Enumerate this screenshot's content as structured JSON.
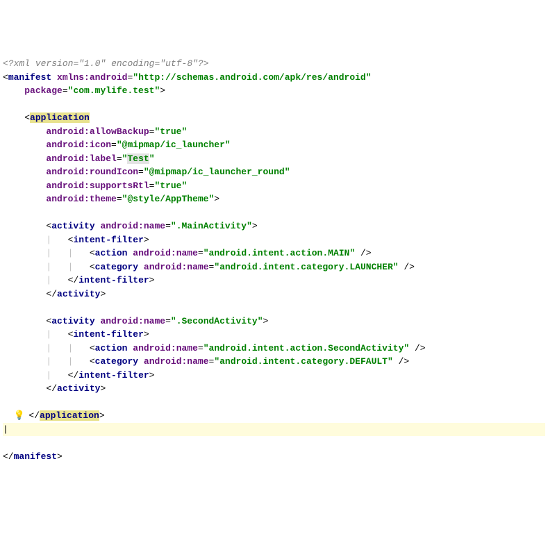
{
  "xml_decl": {
    "open": "<?",
    "name": "xml",
    "version_attr": "version",
    "version_val": "\"1.0\"",
    "encoding_attr": "encoding",
    "encoding_val": "\"utf-8\"",
    "close": "?>"
  },
  "manifest": {
    "tag": "manifest",
    "xmlns_attr": "xmlns:android",
    "xmlns_val": "\"http://schemas.android.com/apk/res/android\"",
    "package_attr": "package",
    "package_val": "\"com.mylife.test\"",
    "close": ">"
  },
  "application": {
    "tag": "application",
    "attrs": {
      "allowBackup": {
        "name": "android:allowBackup",
        "val": "\"true\""
      },
      "icon": {
        "name": "android:icon",
        "val": "\"@mipmap/ic_launcher\""
      },
      "label": {
        "name": "android:label",
        "val_q": "\"",
        "val_inner": "Test",
        "val_q2": "\""
      },
      "roundIcon": {
        "name": "android:roundIcon",
        "val": "\"@mipmap/ic_launcher_round\""
      },
      "supportsRtl": {
        "name": "android:supportsRtl",
        "val": "\"true\""
      },
      "theme": {
        "name": "android:theme",
        "val": "\"@style/AppTheme\""
      }
    },
    "close": ">",
    "close_tag": "application"
  },
  "activity1": {
    "tag": "activity",
    "name_attr": "android:name",
    "name_val": "\".MainActivity\"",
    "close": ">",
    "intent_filter_tag": "intent-filter",
    "action": {
      "tag": "action",
      "attr": "android:name",
      "val": "\"android.intent.action.MAIN\""
    },
    "category": {
      "tag": "category",
      "attr": "android:name",
      "val": "\"android.intent.category.LAUNCHER\""
    }
  },
  "activity2": {
    "tag": "activity",
    "name_attr": "android:name",
    "name_val": "\".SecondActivity\"",
    "close": ">",
    "intent_filter_tag": "intent-filter",
    "action": {
      "tag": "action",
      "attr": "android:name",
      "val": "\"android.intent.action.SecondActivity\""
    },
    "category": {
      "tag": "category",
      "attr": "android:name",
      "val": "\"android.intent.category.DEFAULT\""
    }
  }
}
